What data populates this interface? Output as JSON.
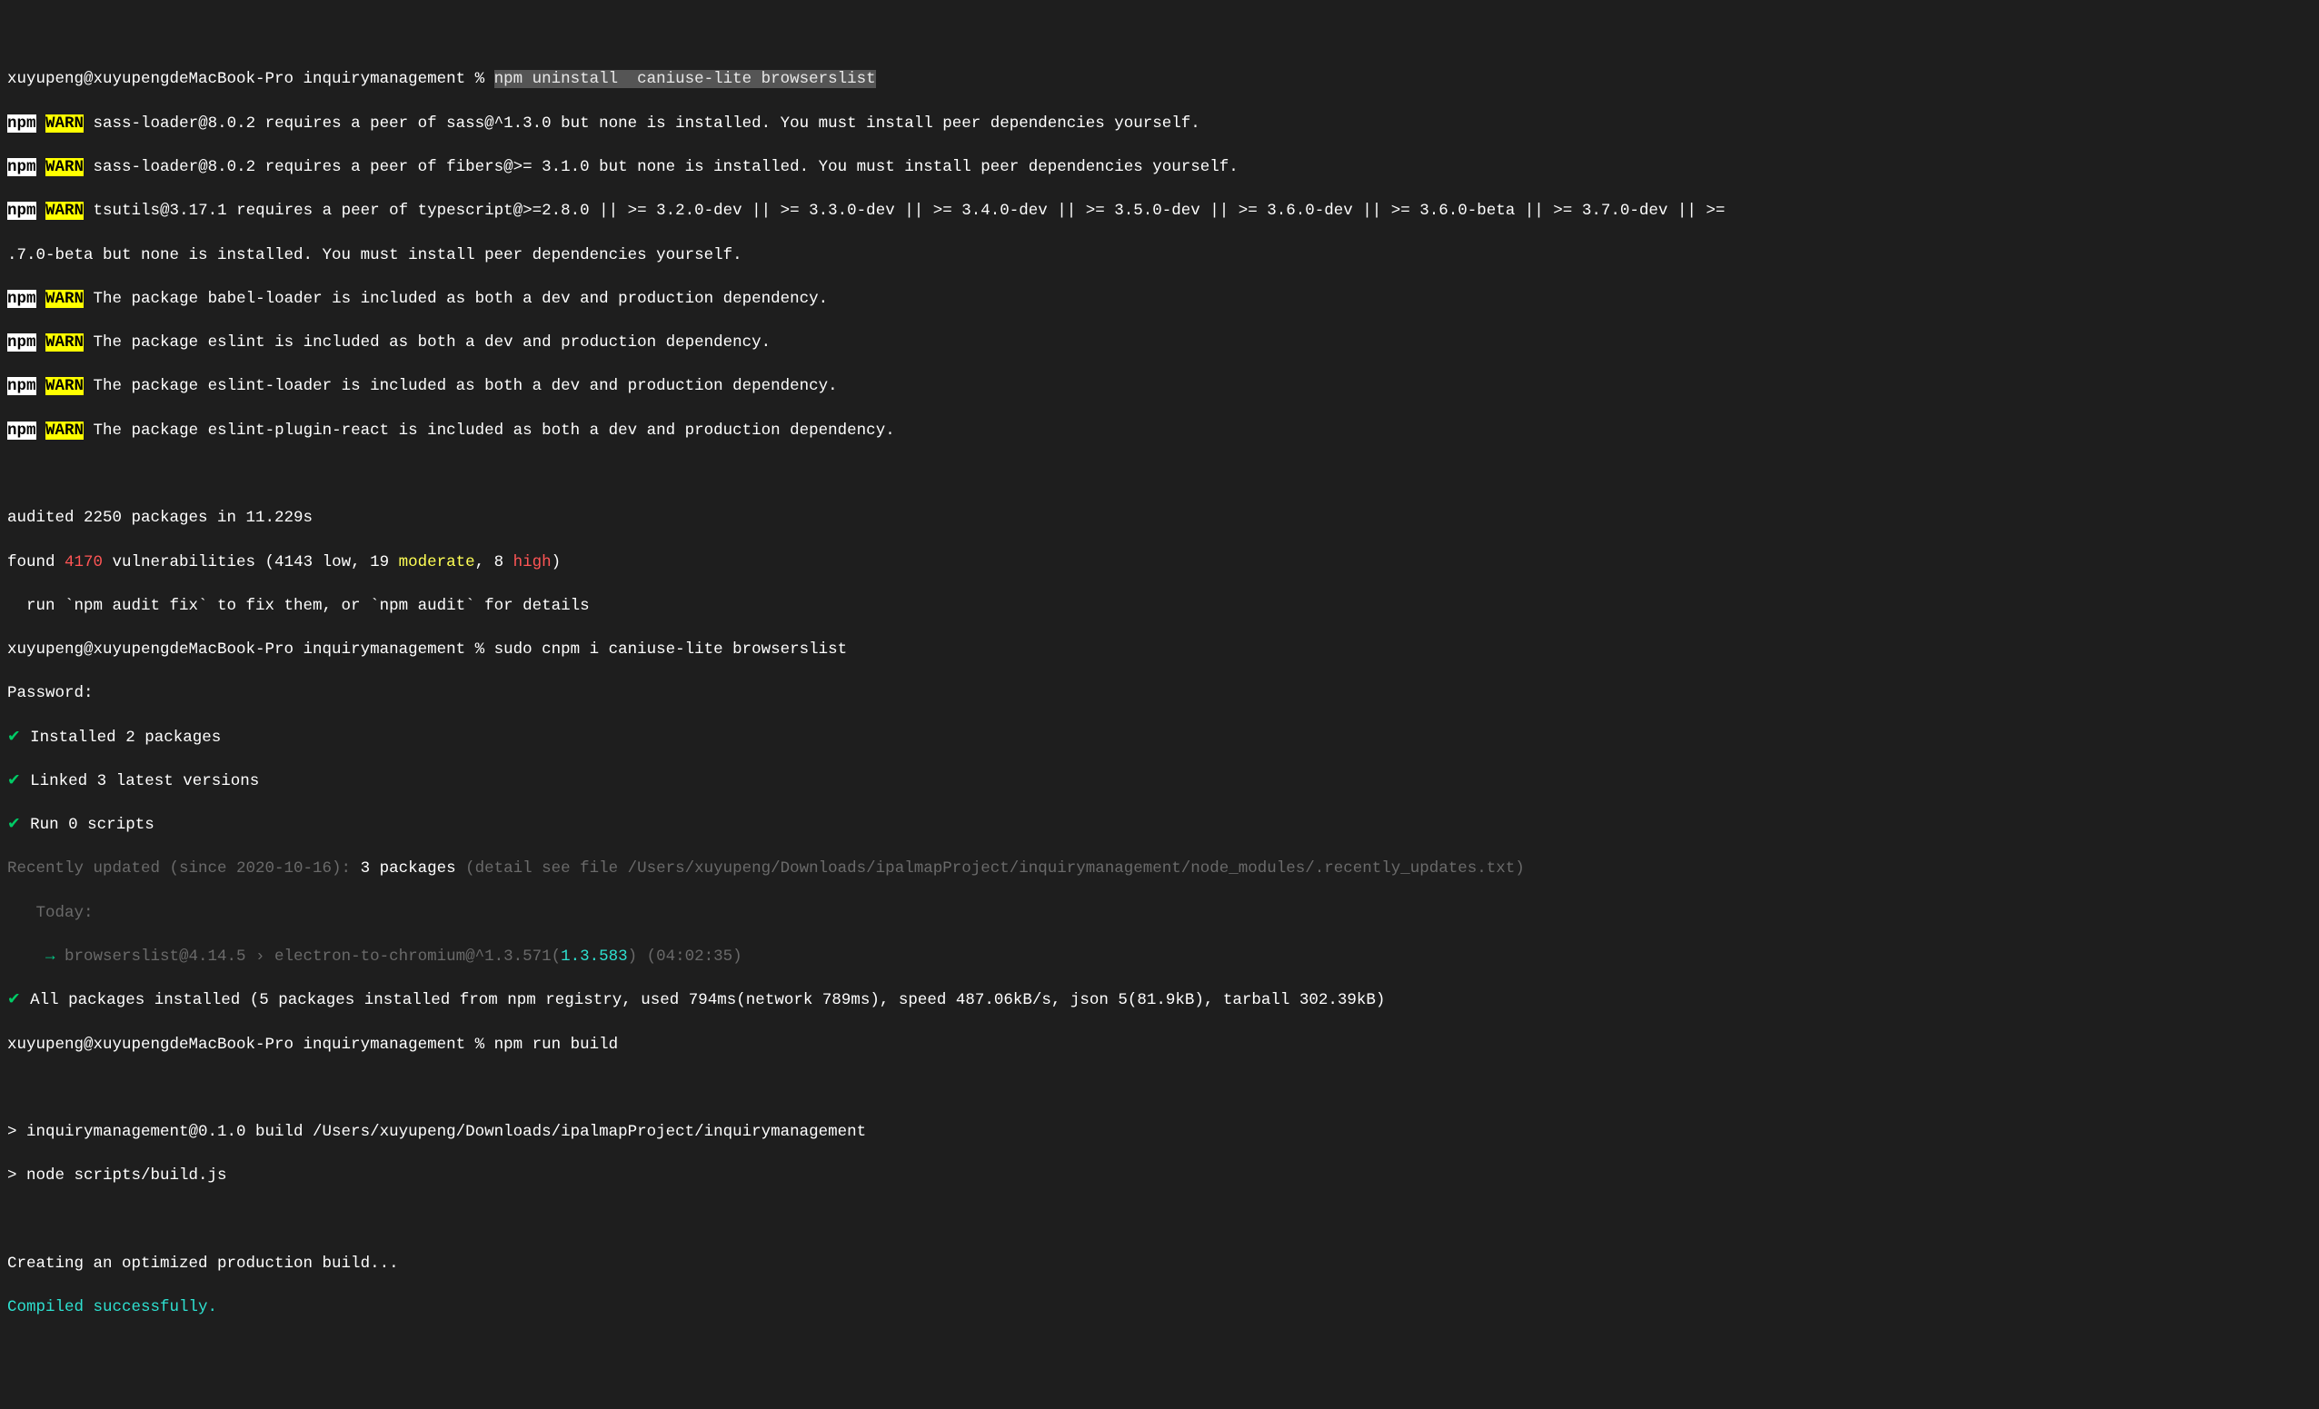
{
  "prompt": "xuyupeng@xuyupengdeMacBook-Pro inquirymanagement %",
  "cmd1_highlight": "npm uninstall  caniuse-lite browserslist",
  "npm_label": "npm",
  "warn_label": "WARN",
  "w1": " sass-loader@8.0.2 requires a peer of sass@^1.3.0 but none is installed. You must install peer dependencies yourself.",
  "w2": " sass-loader@8.0.2 requires a peer of fibers@>= 3.1.0 but none is installed. You must install peer dependencies yourself.",
  "w3a": " tsutils@3.17.1 requires a peer of typescript@>=2.8.0 || >= 3.2.0-dev || >= 3.3.0-dev || >= 3.4.0-dev || >= 3.5.0-dev || >= 3.6.0-dev || >= 3.6.0-beta || >= 3.7.0-dev || >=",
  "w3b": ".7.0-beta but none is installed. You must install peer dependencies yourself.",
  "w4": " The package babel-loader is included as both a dev and production dependency.",
  "w5": " The package eslint is included as both a dev and production dependency.",
  "w6": " The package eslint-loader is included as both a dev and production dependency.",
  "w7": " The package eslint-plugin-react is included as both a dev and production dependency.",
  "audit_line": "audited 2250 packages in 11.229s",
  "found_prefix": "found ",
  "vuln_count": "4170",
  "vuln_mid1": " vulnerabilities (4143 ",
  "low_word": "low",
  "vuln_mid2": ", 19 ",
  "moderate_word": "moderate",
  "vuln_mid3": ", 8 ",
  "high_word": "high",
  "vuln_close": ")",
  "audit_hint": "  run `npm audit fix` to fix them, or `npm audit` for details",
  "cmd2": " sudo cnpm i caniuse-lite browserslist",
  "password_prompt": "Password:",
  "inst_line": " Installed 2 packages",
  "link_line": " Linked 3 latest versions",
  "run_line": " Run 0 scripts",
  "recent_a": "Recently updated (since 2020-10-16): ",
  "recent_count": "3",
  "recent_pkgs": " packages",
  "recent_detail": " (detail see file /Users/xuyupeng/Downloads/ipalmapProject/inquirymanagement/node_modules/.recently_updates.txt)",
  "today_label": "   Today:",
  "arrow_sym": "    → ",
  "dep_a": "browserslist@4.14.5 › electron-to-chromium@^1.3.571(",
  "dep_ver": "1.3.583",
  "dep_b": ")",
  "dep_time": " (04:02:35)",
  "all_prefix": " All packages installed",
  "all_rest": " (5 packages installed from npm registry, used 794ms(network 789ms), speed 487.06kB/s, json 5(81.9kB), tarball 302.39kB)",
  "cmd3": " npm run build",
  "build_line1": "> inquirymanagement@0.1.0 build /Users/xuyupeng/Downloads/ipalmapProject/inquirymanagement",
  "build_line2": "> node scripts/build.js",
  "creating": "Creating an optimized production build...",
  "compiled": "Compiled successfully.",
  "check_sym": "✔"
}
